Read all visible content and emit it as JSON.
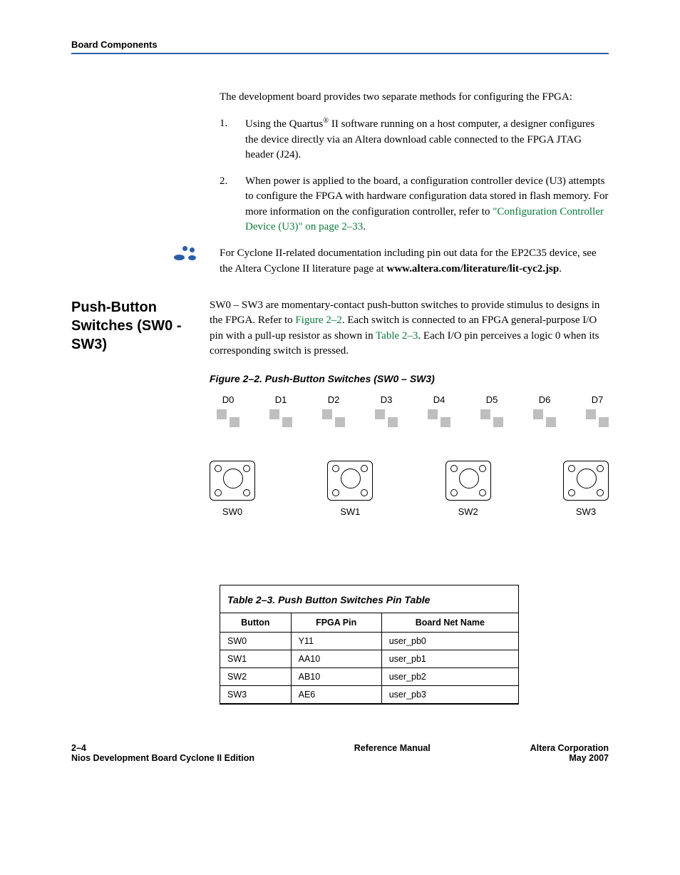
{
  "header": {
    "section": "Board Components"
  },
  "intro": {
    "lead": "The development board provides two separate methods for configuring the FPGA:",
    "items": [
      {
        "num": "1.",
        "pre": "Using the Quartus",
        "reg": "®",
        "post": " II software running on a host computer, a designer configures the device directly via an Altera download cable connected to the FPGA JTAG header (J24)."
      },
      {
        "num": "2.",
        "pre": "When power is applied to the board, a configuration controller device (U3) attempts to configure the FPGA with hardware configuration data stored in flash memory. For more information on the configuration controller, refer to ",
        "xref": "\"Configuration Controller Device (U3)\" on page 2–33",
        "post2": "."
      }
    ],
    "footnote": {
      "line1": "For Cyclone II-related documentation including pin out data for the EP2C35 device, see the Altera Cyclone II literature page at ",
      "bold": "www.altera.com/literature/lit-cyc2.jsp",
      "end": "."
    }
  },
  "section": {
    "heading": "Push-Button Switches (SW0 - SW3)",
    "para_pre": "SW0 – SW3 are momentary-contact push-button switches to provide stimulus to designs in the FPGA. Refer to ",
    "fig_xref": "Figure 2–2",
    "para_mid": ". Each switch is connected to an FPGA general-purpose I/O pin with a pull-up resistor as shown in ",
    "tab_xref": "Table 2–3",
    "para_post": ". Each I/O pin perceives a logic 0 when its corresponding switch is pressed."
  },
  "figure": {
    "caption": "Figure 2–2. Push-Button Switches (SW0 – SW3)",
    "leds": [
      "D0",
      "D1",
      "D2",
      "D3",
      "D4",
      "D5",
      "D6",
      "D7"
    ],
    "switches": [
      "SW0",
      "SW1",
      "SW2",
      "SW3"
    ]
  },
  "table": {
    "caption": "Table 2–3. Push Button Switches Pin Table",
    "headers": [
      "Button",
      "FPGA Pin",
      "Board Net Name"
    ],
    "rows": [
      [
        "SW0",
        "Y11",
        "user_pb0"
      ],
      [
        "SW1",
        "AA10",
        "user_pb1"
      ],
      [
        "SW2",
        "AB10",
        "user_pb2"
      ],
      [
        "SW3",
        "AE6",
        "user_pb3"
      ]
    ]
  },
  "chart_data": {
    "type": "table",
    "title": "Table 2–3. Push Button Switches Pin Table",
    "columns": [
      "Button",
      "FPGA Pin",
      "Board Net Name"
    ],
    "rows": [
      {
        "Button": "SW0",
        "FPGA Pin": "Y11",
        "Board Net Name": "user_pb0"
      },
      {
        "Button": "SW1",
        "FPGA Pin": "AA10",
        "Board Net Name": "user_pb1"
      },
      {
        "Button": "SW2",
        "FPGA Pin": "AB10",
        "Board Net Name": "user_pb2"
      },
      {
        "Button": "SW3",
        "FPGA Pin": "AE6",
        "Board Net Name": "user_pb3"
      }
    ]
  },
  "footer": {
    "page_left1": "2–4",
    "page_left2": "Nios Development Board Cyclone II Edition",
    "center": "Reference Manual",
    "right1": "Altera Corporation",
    "right2": "May 2007"
  }
}
